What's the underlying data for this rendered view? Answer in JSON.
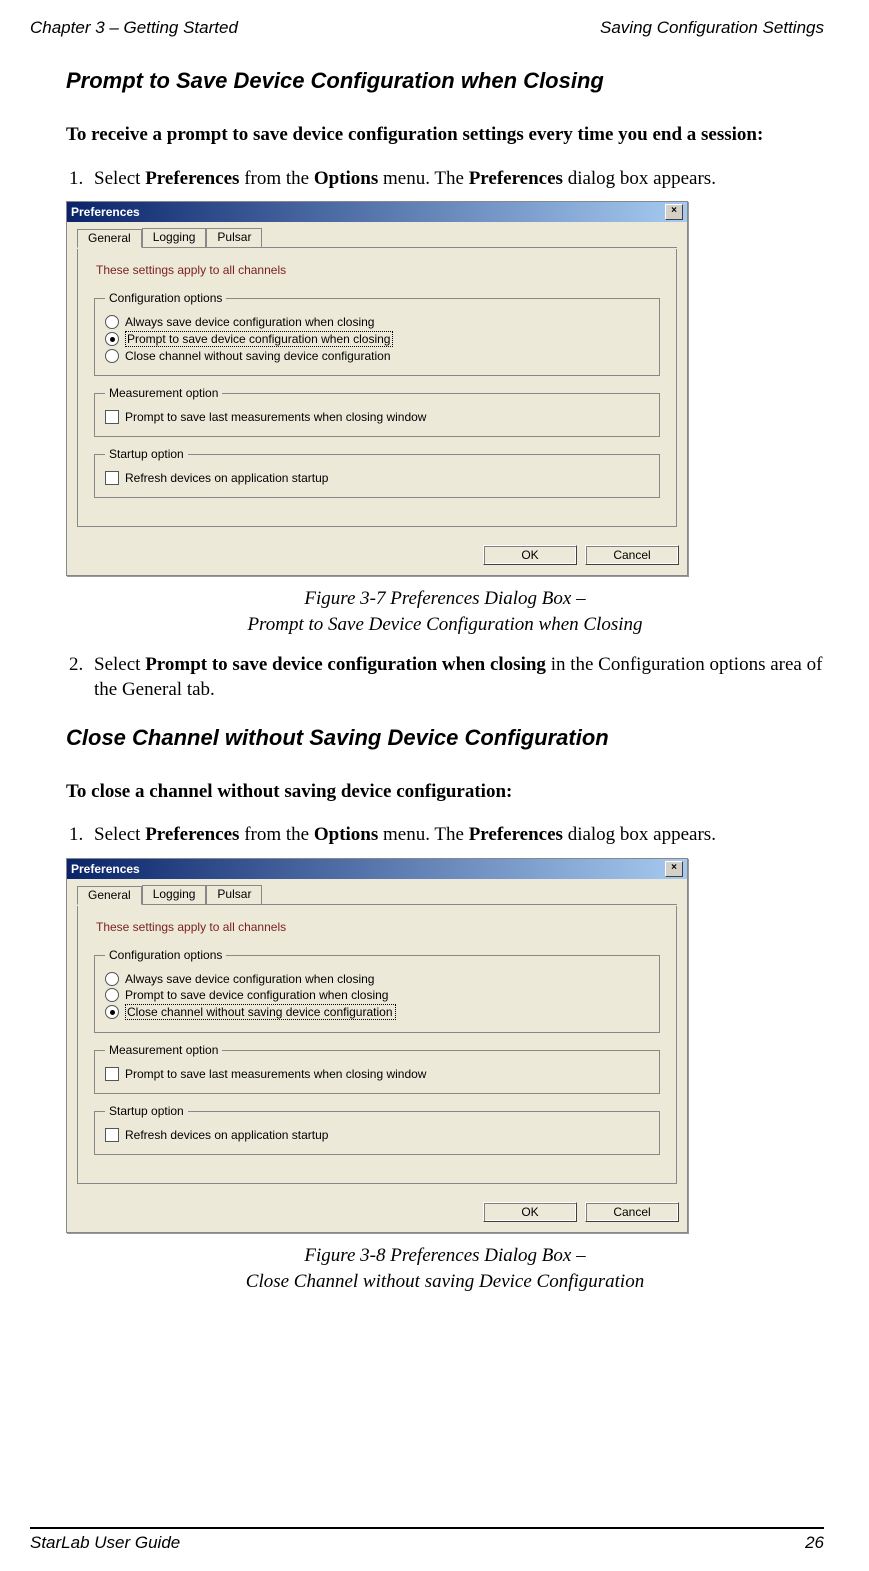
{
  "header": {
    "left": "Chapter 3 – Getting Started",
    "right": "Saving Configuration Settings"
  },
  "section1": {
    "heading": "Prompt to Save Device Configuration when Closing",
    "lead": "To receive a prompt to save device configuration settings every time you end a session:",
    "step1_pre": "Select ",
    "step1_b1": "Preferences",
    "step1_mid": " from the ",
    "step1_b2": "Options",
    "step1_mid2": " menu. The ",
    "step1_b3": "Preferences",
    "step1_post": " dialog box appears.",
    "caption_l1": "Figure 3-7 Preferences Dialog Box –",
    "caption_l2": "Prompt to Save Device Configuration when Closing",
    "step2_pre": "Select ",
    "step2_b": "Prompt to save device configuration when closing",
    "step2_post": " in the Configuration options area of the General tab."
  },
  "section2": {
    "heading": "Close Channel without Saving Device Configuration",
    "lead": "To close a channel without saving device configuration:",
    "step1_pre": "Select ",
    "step1_b1": "Preferences",
    "step1_mid": " from the ",
    "step1_b2": "Options",
    "step1_mid2": " menu. The ",
    "step1_b3": "Preferences",
    "step1_post": " dialog box appears.",
    "caption_l1": "Figure 3-8 Preferences Dialog Box –",
    "caption_l2": "Close Channel without saving Device Configuration"
  },
  "dialog": {
    "title": "Preferences",
    "close_glyph": "×",
    "tabs": {
      "general": "General",
      "logging": "Logging",
      "pulsar": "Pulsar"
    },
    "note": "These settings apply to all channels",
    "grp_config": "Configuration options",
    "opt_always": "Always save device configuration when closing",
    "opt_prompt": "Prompt to save device configuration when closing",
    "opt_close": "Close channel without saving device configuration",
    "grp_meas": "Measurement option",
    "chk_meas": "Prompt to save last measurements when closing window",
    "grp_start": "Startup option",
    "chk_start": "Refresh devices on application startup",
    "btn_ok": "OK",
    "btn_cancel": "Cancel",
    "selected_variant_a": 1,
    "selected_variant_b": 2
  },
  "footer": {
    "left": "StarLab User Guide",
    "right": "26"
  }
}
